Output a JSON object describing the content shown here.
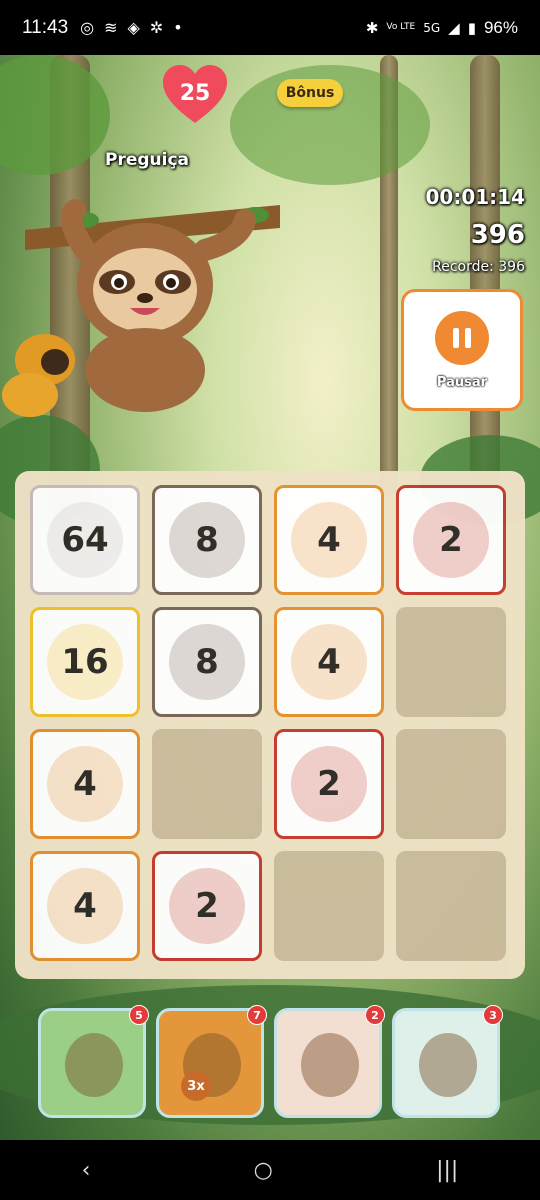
{
  "status_bar": {
    "time": "11:43",
    "left_icons": [
      "whatsapp-icon",
      "signal-app-icon",
      "app-icon",
      "settings-icon",
      "dot-icon"
    ],
    "network_small": "Vo LTE",
    "network": "5G",
    "battery": "96%"
  },
  "game": {
    "lives": "25",
    "bonus_label": "Bônus",
    "animal_name": "Preguiça",
    "timer": "00:01:14",
    "score": "396",
    "record": "Recorde: 396",
    "pause_label": "Pausar"
  },
  "board": {
    "tiles": [
      {
        "value": "64",
        "color": "#c8bcbc",
        "animal": "sloth"
      },
      {
        "value": "8",
        "color": "#7a6556",
        "animal": "frog"
      },
      {
        "value": "4",
        "color": "#e6902e",
        "animal": "fox"
      },
      {
        "value": "2",
        "color": "#c63a2e",
        "animal": "ant"
      },
      {
        "value": "16",
        "color": "#f2c12a",
        "animal": "toucan"
      },
      {
        "value": "8",
        "color": "#7a6556",
        "animal": "frog"
      },
      {
        "value": "4",
        "color": "#e6902e",
        "animal": "fox"
      },
      {
        "value": "",
        "color": "",
        "animal": ""
      },
      {
        "value": "4",
        "color": "#e6902e",
        "animal": "fox"
      },
      {
        "value": "",
        "color": "",
        "animal": ""
      },
      {
        "value": "2",
        "color": "#c63a2e",
        "animal": "ant"
      },
      {
        "value": "",
        "color": "",
        "animal": ""
      },
      {
        "value": "4",
        "color": "#e6902e",
        "animal": "fox"
      },
      {
        "value": "2",
        "color": "#c63a2e",
        "animal": "ant"
      },
      {
        "value": "",
        "color": "",
        "animal": ""
      },
      {
        "value": "",
        "color": "",
        "animal": ""
      }
    ]
  },
  "powerups": [
    {
      "name": "snake",
      "count": "5",
      "bg": "#9ccf86",
      "mult": ""
    },
    {
      "name": "lion-tamarin",
      "count": "7",
      "bg": "#e3963a",
      "mult": "3x"
    },
    {
      "name": "capybara",
      "count": "2",
      "bg": "#f3dfd2",
      "mult": ""
    },
    {
      "name": "jaguar",
      "count": "3",
      "bg": "#dff0ea",
      "mult": ""
    }
  ],
  "nav": {
    "back": "‹",
    "home": "○",
    "recents": "|||"
  }
}
